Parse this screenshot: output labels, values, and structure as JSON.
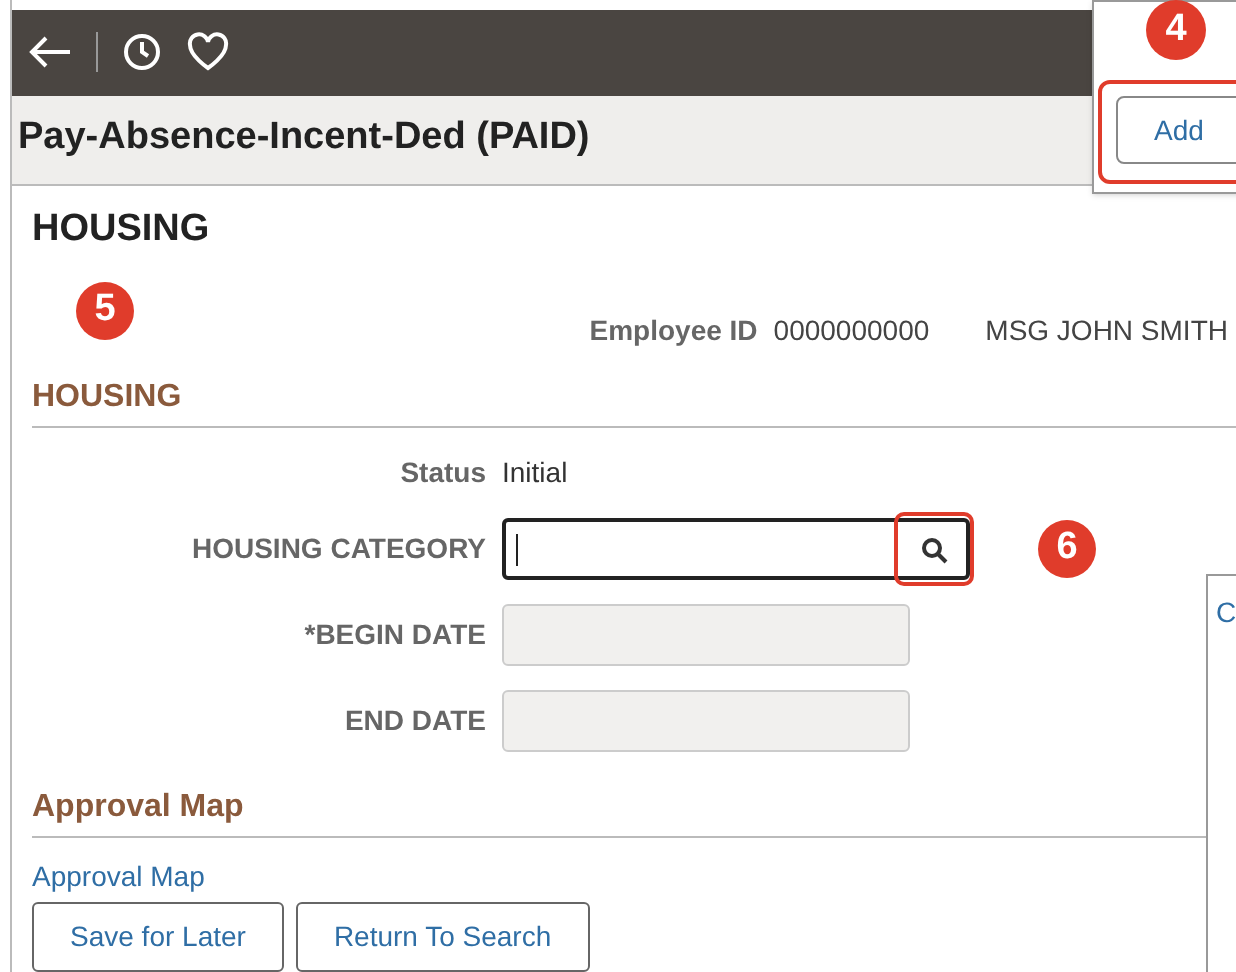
{
  "page_title": "Pay-Absence-Incent-Ded (PAID)",
  "popup": {
    "callout": "4",
    "add_button": {
      "label": "Add",
      "highlighted": true
    }
  },
  "heading": "HOUSING",
  "callout_main": "5",
  "employee": {
    "label": "Employee ID",
    "id": "0000000000",
    "name": "MSG JOHN SMITH"
  },
  "section": "HOUSING",
  "fields": [
    {
      "kind": "text",
      "label": "Status",
      "value": "Initial"
    },
    {
      "kind": "lookup",
      "label": "HOUSING CATEGORY",
      "focused": true,
      "lookup_highlighted": true,
      "callout": "6"
    },
    {
      "kind": "date",
      "label": "*BEGIN DATE",
      "focused": false
    },
    {
      "kind": "date",
      "label": "END DATE",
      "focused": false
    }
  ],
  "approval": {
    "heading": "Approval Map",
    "link": "Approval Map"
  },
  "buttons": [
    "Save for Later",
    "Return To Search"
  ],
  "side_window": {
    "text": "C"
  }
}
